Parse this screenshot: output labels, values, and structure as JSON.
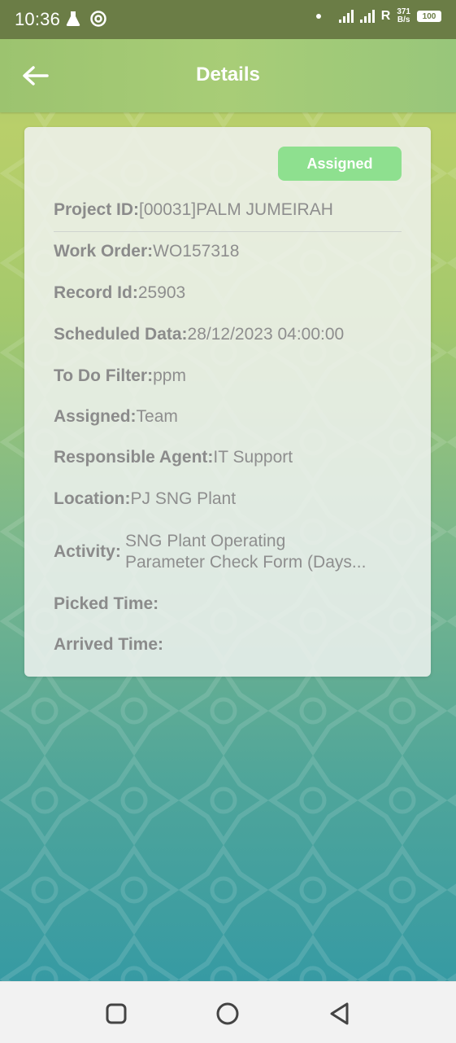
{
  "status_bar": {
    "time": "10:36",
    "network_speed_value": "371",
    "network_speed_unit": "B/s",
    "roaming": "R",
    "battery": "100"
  },
  "app_bar": {
    "title": "Details"
  },
  "card": {
    "status_badge": "Assigned",
    "fields": {
      "project_id": {
        "label": "Project ID:",
        "value": "[00031]PALM JUMEIRAH"
      },
      "work_order": {
        "label": "Work Order:",
        "value": "WO157318"
      },
      "record_id": {
        "label": "Record Id:",
        "value": "25903"
      },
      "scheduled": {
        "label": "Scheduled Data:",
        "value": "28/12/2023 04:00:00"
      },
      "todo_filter": {
        "label": "To Do Filter:",
        "value": "ppm"
      },
      "assigned": {
        "label": "Assigned:",
        "value": "Team"
      },
      "agent": {
        "label": "Responsible Agent:",
        "value": "IT Support"
      },
      "location": {
        "label": "Location:",
        "value": "PJ SNG Plant"
      },
      "activity": {
        "label": "Activity:",
        "line1": "SNG Plant Operating",
        "line2": "Parameter Check Form (Days..."
      },
      "picked_time": {
        "label": "Picked Time:",
        "value": ""
      },
      "arrived_time": {
        "label": "Arrived Time:",
        "value": ""
      }
    }
  },
  "colors": {
    "badge": "#8ee08f",
    "app_bar": "#a8cd77",
    "status_bar": "#6b7d46"
  },
  "icons": [
    "flask-icon",
    "sync-icon",
    "signal-icon",
    "back-arrow-icon",
    "recent-apps-icon",
    "home-icon",
    "nav-back-icon"
  ]
}
